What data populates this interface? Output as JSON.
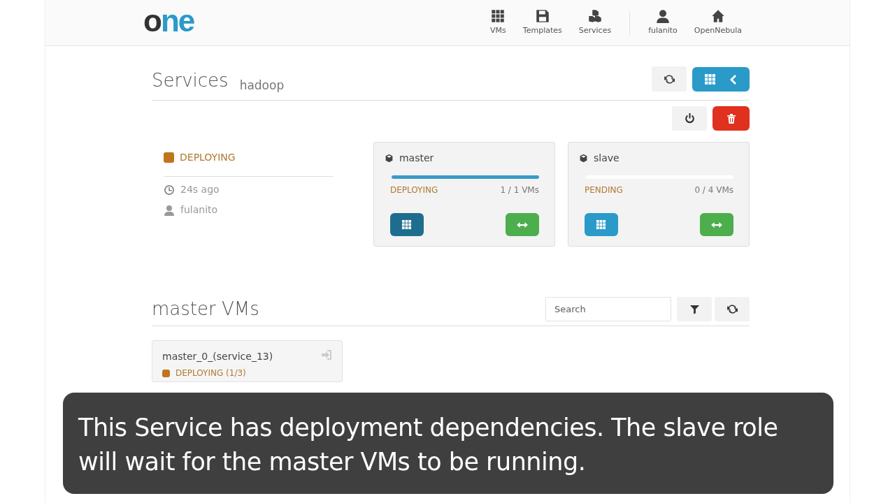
{
  "header": {
    "logo": {
      "dark": "o",
      "accent": "ne"
    },
    "nav": [
      {
        "label": "VMs"
      },
      {
        "label": "Templates"
      },
      {
        "label": "Services"
      },
      {
        "label": "fulanito"
      },
      {
        "label": "OpenNebula"
      }
    ]
  },
  "title": {
    "main": "Services",
    "sub": "hadoop"
  },
  "service": {
    "state": "DEPLOYING",
    "color": "#c0741c",
    "time": "24s ago",
    "owner": "fulanito"
  },
  "roles": [
    {
      "name": "master",
      "level": 1,
      "state": "DEPLOYING",
      "count": "1 / 1 VMs",
      "selected": true
    },
    {
      "name": "slave",
      "level": 0,
      "state": "PENDING",
      "count": "0 / 4 VMs",
      "selected": false
    }
  ],
  "vms_section": {
    "title": "master VMs",
    "search": {
      "placeholder": "Search"
    }
  },
  "vms": [
    {
      "name": "master_0_(service_13)",
      "state": "DEPLOYING (1/3)",
      "color": "#c0741c"
    }
  ],
  "caption": "This Service has deployment dependencies. The slave role will wait for the master VMs to be running."
}
